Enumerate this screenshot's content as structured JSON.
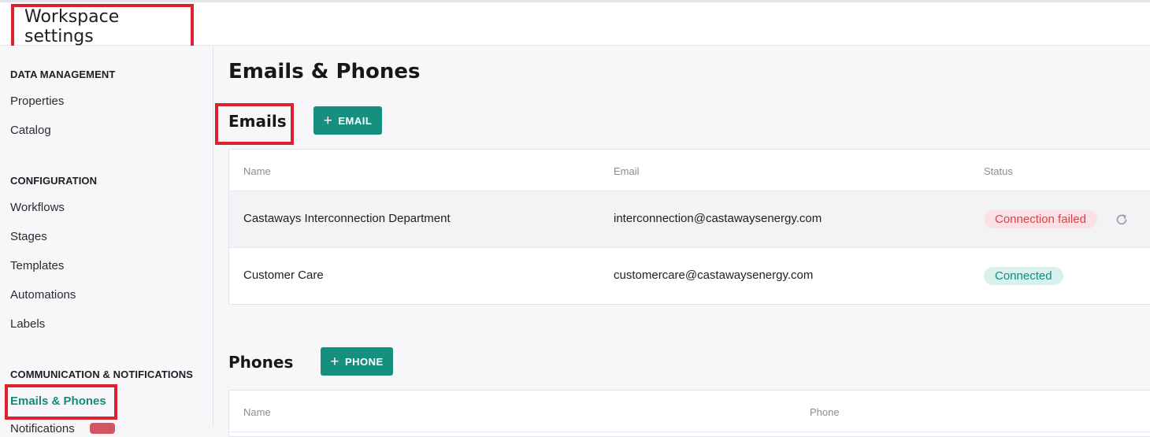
{
  "header": {
    "title": "Workspace settings"
  },
  "sidebar": {
    "sections": [
      {
        "heading": "DATA MANAGEMENT",
        "items": [
          "Properties",
          "Catalog"
        ]
      },
      {
        "heading": "CONFIGURATION",
        "items": [
          "Workflows",
          "Stages",
          "Templates",
          "Automations",
          "Labels"
        ]
      },
      {
        "heading": "COMMUNICATION & NOTIFICATIONS",
        "items": [
          "Emails & Phones",
          "Notifications"
        ]
      }
    ]
  },
  "main": {
    "title": "Emails & Phones",
    "emails": {
      "label": "Emails",
      "add_button": "EMAIL",
      "columns": [
        "Name",
        "Email",
        "Status"
      ],
      "rows": [
        {
          "name": "Castaways Interconnection Department",
          "email": "interconnection@castawaysenergy.com",
          "status": "Connection failed"
        },
        {
          "name": "Customer Care",
          "email": "customercare@castawaysenergy.com",
          "status": "Connected"
        }
      ]
    },
    "phones": {
      "label": "Phones",
      "add_button": "PHONE",
      "columns": [
        "Name",
        "Phone"
      ]
    }
  },
  "colors": {
    "accent": "#15907f",
    "highlight_box": "#d9232e",
    "status_failed": "#d2434f",
    "status_connected": "#138a7c"
  },
  "icons": {
    "add": "plus-icon",
    "retry": "refresh-icon"
  }
}
